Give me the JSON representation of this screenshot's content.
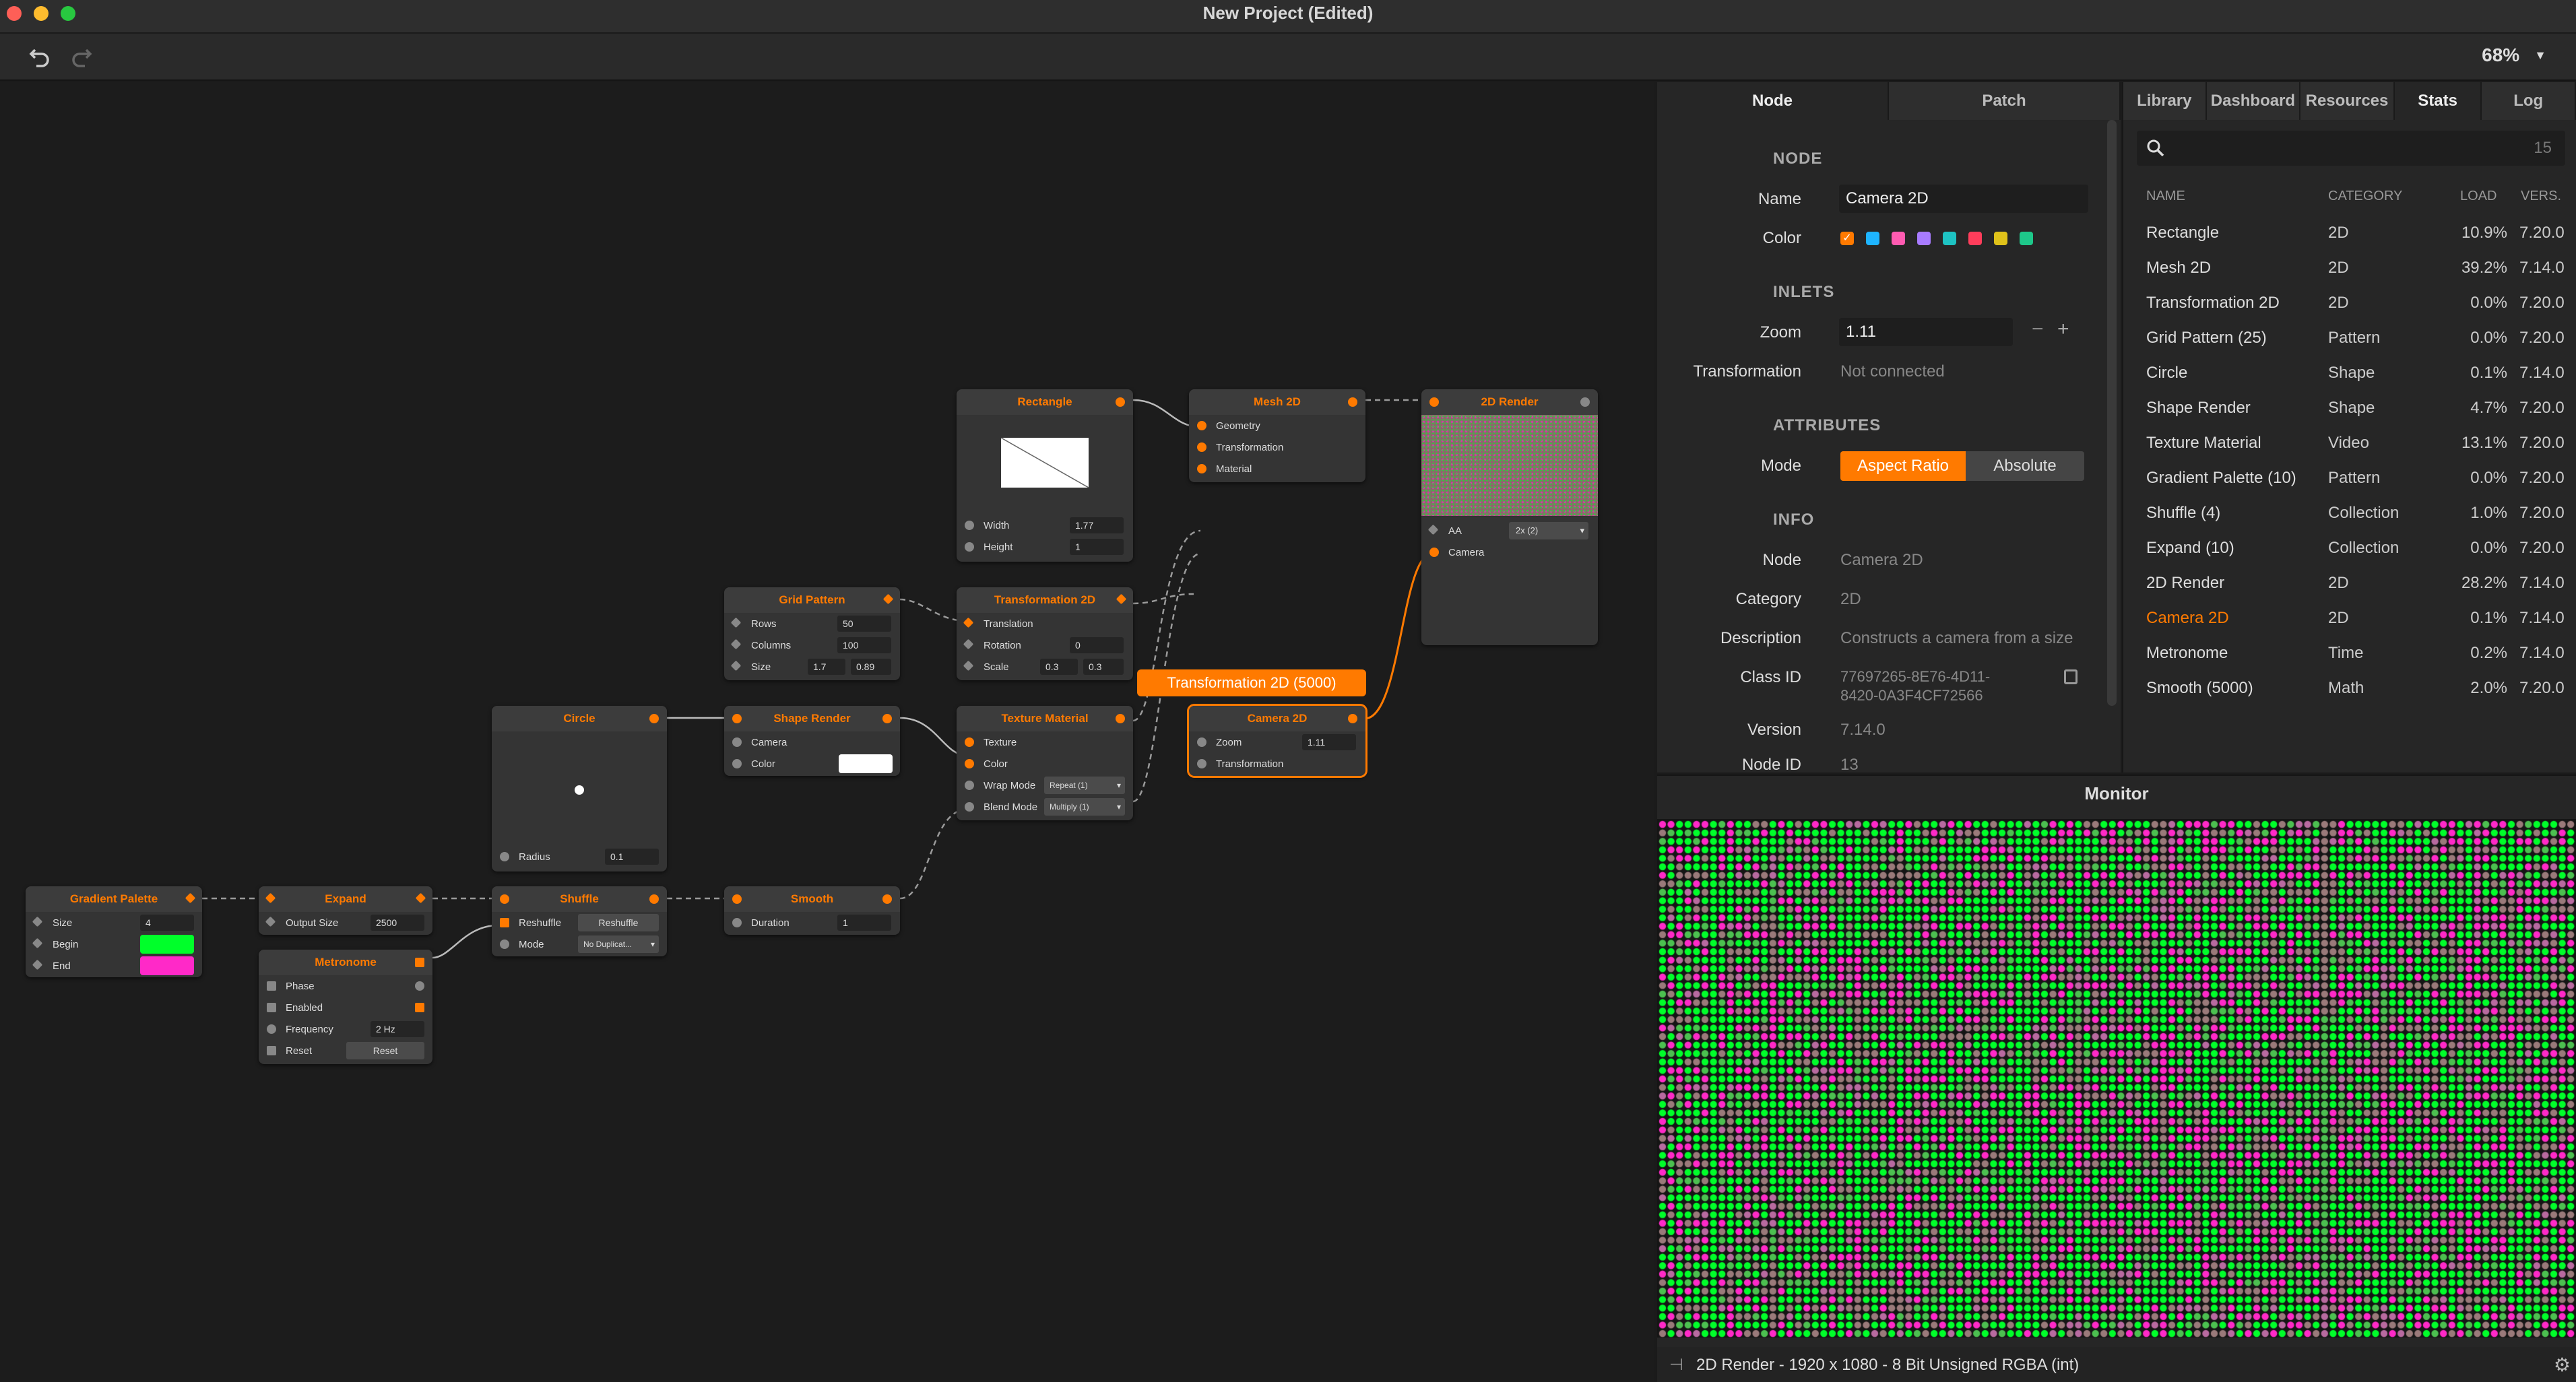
{
  "window": {
    "title": "New Project (Edited)"
  },
  "toolbar": {
    "zoom": "68%"
  },
  "colors": {
    "accent": "#ff7a00",
    "green": "#00ff2a",
    "pink": "#ff29c8"
  },
  "nodes": {
    "gradient": {
      "title": "Gradient Palette",
      "size_label": "Size",
      "size_value": "4",
      "begin_label": "Begin",
      "end_label": "End"
    },
    "expand": {
      "title": "Expand",
      "output_label": "Output Size",
      "output_value": "2500"
    },
    "metronome": {
      "title": "Metronome",
      "phase": "Phase",
      "enabled": "Enabled",
      "freq_label": "Frequency",
      "freq_value": "2 Hz",
      "reset_label": "Reset",
      "reset_btn": "Reset"
    },
    "shuffle": {
      "title": "Shuffle",
      "reshuffle_label": "Reshuffle",
      "reshuffle_btn": "Reshuffle",
      "mode_label": "Mode",
      "mode_value": "No Duplicat..."
    },
    "smooth": {
      "title": "Smooth",
      "duration_label": "Duration",
      "duration_value": "1"
    },
    "circle": {
      "title": "Circle",
      "radius_label": "Radius",
      "radius_value": "0.1"
    },
    "shape_render": {
      "title": "Shape Render",
      "camera_label": "Camera",
      "color_label": "Color"
    },
    "grid": {
      "title": "Grid Pattern",
      "rows_label": "Rows",
      "rows_value": "50",
      "cols_label": "Columns",
      "cols_value": "100",
      "size_label": "Size",
      "size_w": "1.7",
      "size_h": "0.89"
    },
    "rectangle": {
      "title": "Rectangle",
      "width_label": "Width",
      "width_value": "1.77",
      "height_label": "Height",
      "height_value": "1"
    },
    "transform": {
      "title": "Transformation 2D",
      "t_label": "Translation",
      "r_label": "Rotation",
      "r_value": "0",
      "s_label": "Scale",
      "s_x": "0.3",
      "s_y": "0.3"
    },
    "texture": {
      "title": "Texture Material",
      "tex_label": "Texture",
      "color_label": "Color",
      "wrap_label": "Wrap Mode",
      "wrap_value": "Repeat (1)",
      "blend_label": "Blend Mode",
      "blend_value": "Multiply (1)"
    },
    "mesh": {
      "title": "Mesh 2D",
      "geo_label": "Geometry",
      "tr_label": "Transformation",
      "mat_label": "Material"
    },
    "render": {
      "title": "2D Render",
      "aa_label": "AA",
      "aa_value": "2x (2)",
      "camera_label": "Camera"
    },
    "camera": {
      "title": "Camera 2D",
      "zoom_label": "Zoom",
      "zoom_value": "1.11",
      "tr_label": "Transformation"
    }
  },
  "tooltip": "Transformation 2D (5000)",
  "inspector": {
    "tabs": [
      "Node",
      "Patch"
    ],
    "sections": {
      "node": "NODE",
      "inlets": "INLETS",
      "attributes": "ATTRIBUTES",
      "info": "INFO"
    },
    "name_label": "Name",
    "name_value": "Camera 2D",
    "color_label": "Color",
    "swatches": [
      "#1eb4ff",
      "#ff5bb1",
      "#a87bff",
      "#1ec3c3",
      "#ff3d5b",
      "#e0c21a",
      "#1ec88a"
    ],
    "zoom_label": "Zoom",
    "zoom_value": "1.11",
    "transformation_label": "Transformation",
    "transformation_value": "Not connected",
    "mode_label": "Mode",
    "mode_options": [
      "Aspect Ratio",
      "Absolute"
    ],
    "info_node_label": "Node",
    "info_node_value": "Camera 2D",
    "category_label": "Category",
    "category_value": "2D",
    "description_label": "Description",
    "description_value": "Constructs a camera from a size",
    "classid_label": "Class ID",
    "classid_line1": "77697265-8E76-4D11-",
    "classid_line2": "8420-0A3F4CF72566",
    "version_label": "Version",
    "version_value": "7.14.0",
    "nodeid_label": "Node ID",
    "nodeid_value": "13"
  },
  "library": {
    "tabs": [
      "Library",
      "Dashboard",
      "Resources",
      "Stats",
      "Log"
    ],
    "count": "15",
    "headers": {
      "name": "NAME",
      "category": "CATEGORY",
      "load": "LOAD",
      "version": "VERS."
    },
    "rows": [
      {
        "name": "Rectangle",
        "category": "2D",
        "load": "10.9%",
        "version": "7.20.0"
      },
      {
        "name": "Mesh 2D",
        "category": "2D",
        "load": "39.2%",
        "version": "7.14.0"
      },
      {
        "name": "Transformation 2D",
        "category": "2D",
        "load": "0.0%",
        "version": "7.20.0"
      },
      {
        "name": "Grid Pattern (25)",
        "category": "Pattern",
        "load": "0.0%",
        "version": "7.20.0"
      },
      {
        "name": "Circle",
        "category": "Shape",
        "load": "0.1%",
        "version": "7.14.0"
      },
      {
        "name": "Shape Render",
        "category": "Shape",
        "load": "4.7%",
        "version": "7.20.0"
      },
      {
        "name": "Texture Material",
        "category": "Video",
        "load": "13.1%",
        "version": "7.20.0"
      },
      {
        "name": "Gradient Palette (10)",
        "category": "Pattern",
        "load": "0.0%",
        "version": "7.20.0"
      },
      {
        "name": "Shuffle (4)",
        "category": "Collection",
        "load": "1.0%",
        "version": "7.20.0"
      },
      {
        "name": "Expand (10)",
        "category": "Collection",
        "load": "0.0%",
        "version": "7.20.0"
      },
      {
        "name": "2D Render",
        "category": "2D",
        "load": "28.2%",
        "version": "7.14.0"
      },
      {
        "name": "Camera 2D",
        "category": "2D",
        "load": "0.1%",
        "version": "7.14.0",
        "highlight": true
      },
      {
        "name": "Metronome",
        "category": "Time",
        "load": "0.2%",
        "version": "7.14.0"
      },
      {
        "name": "Smooth (5000)",
        "category": "Math",
        "load": "2.0%",
        "version": "7.20.0"
      }
    ]
  },
  "monitor": {
    "title": "Monitor",
    "status": "2D Render - 1920 x 1080 - 8 Bit Unsigned RGBA (int)"
  }
}
